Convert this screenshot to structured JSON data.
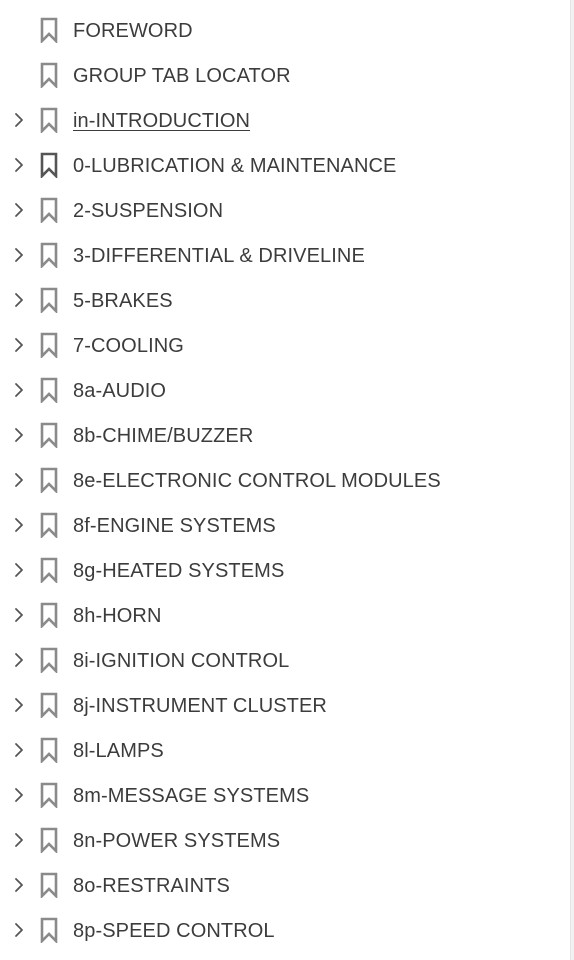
{
  "bookmarks": {
    "items": [
      {
        "label": "FOREWORD",
        "expandable": false,
        "underlined": false,
        "icon": "bookmark-icon"
      },
      {
        "label": "GROUP TAB LOCATOR",
        "expandable": false,
        "underlined": false,
        "icon": "bookmark-icon"
      },
      {
        "label": "in-INTRODUCTION",
        "expandable": true,
        "underlined": true,
        "icon": "bookmark-icon"
      },
      {
        "label": "0-LUBRICATION & MAINTENANCE",
        "expandable": true,
        "underlined": false,
        "icon": "bookmark-icon",
        "dark": true
      },
      {
        "label": "2-SUSPENSION",
        "expandable": true,
        "underlined": false,
        "icon": "bookmark-icon"
      },
      {
        "label": "3-DIFFERENTIAL & DRIVELINE",
        "expandable": true,
        "underlined": false,
        "icon": "bookmark-icon"
      },
      {
        "label": "5-BRAKES",
        "expandable": true,
        "underlined": false,
        "icon": "bookmark-icon"
      },
      {
        "label": "7-COOLING",
        "expandable": true,
        "underlined": false,
        "icon": "bookmark-icon"
      },
      {
        "label": "8a-AUDIO",
        "expandable": true,
        "underlined": false,
        "icon": "bookmark-icon"
      },
      {
        "label": "8b-CHIME/BUZZER",
        "expandable": true,
        "underlined": false,
        "icon": "bookmark-icon"
      },
      {
        "label": "8e-ELECTRONIC CONTROL MODULES",
        "expandable": true,
        "underlined": false,
        "icon": "bookmark-icon"
      },
      {
        "label": "8f-ENGINE SYSTEMS",
        "expandable": true,
        "underlined": false,
        "icon": "bookmark-icon"
      },
      {
        "label": "8g-HEATED SYSTEMS",
        "expandable": true,
        "underlined": false,
        "icon": "bookmark-icon"
      },
      {
        "label": "8h-HORN",
        "expandable": true,
        "underlined": false,
        "icon": "bookmark-icon"
      },
      {
        "label": "8i-IGNITION CONTROL",
        "expandable": true,
        "underlined": false,
        "icon": "bookmark-icon"
      },
      {
        "label": "8j-INSTRUMENT CLUSTER",
        "expandable": true,
        "underlined": false,
        "icon": "bookmark-icon"
      },
      {
        "label": "8l-LAMPS",
        "expandable": true,
        "underlined": false,
        "icon": "bookmark-icon"
      },
      {
        "label": "8m-MESSAGE SYSTEMS",
        "expandable": true,
        "underlined": false,
        "icon": "bookmark-icon"
      },
      {
        "label": "8n-POWER SYSTEMS",
        "expandable": true,
        "underlined": false,
        "icon": "bookmark-icon"
      },
      {
        "label": "8o-RESTRAINTS",
        "expandable": true,
        "underlined": false,
        "icon": "bookmark-icon"
      },
      {
        "label": "8p-SPEED CONTROL",
        "expandable": true,
        "underlined": false,
        "icon": "bookmark-icon"
      }
    ]
  },
  "colors": {
    "text": "#3c3c3c",
    "icon": "#8a8a8a",
    "icon_dark": "#555555",
    "chevron": "#555555",
    "background": "#ffffff"
  }
}
